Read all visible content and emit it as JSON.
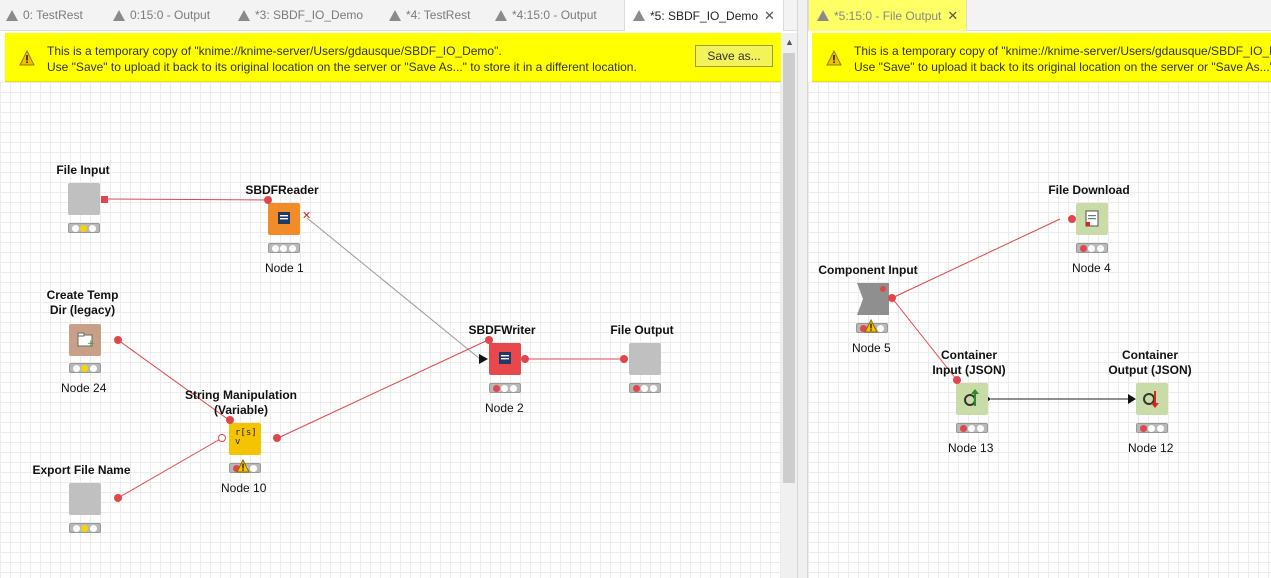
{
  "tabs": [
    {
      "label": "0: TestRest"
    },
    {
      "label": "0:15:0 - Output"
    },
    {
      "label": "*3: SBDF_IO_Demo"
    },
    {
      "label": "*4: TestRest"
    },
    {
      "label": "*4:15:0 - Output"
    },
    {
      "label": "*5: SBDF_IO_Demo"
    },
    {
      "label": "*5:15:0 - File Output"
    }
  ],
  "banner": {
    "line1": "This is a temporary copy of \"knime://knime-server/Users/gdausque/SBDF_IO_Demo\".",
    "line2": "Use \"Save\" to upload it back to its original location on the server or \"Save As...\" to store it in a different location.",
    "save_as": "Save as...",
    "line1_right": "This is a temporary copy of \"knime://knime-server/Users/gdausque/SBDF_IO_De",
    "line2_right": "Use \"Save\" to upload it back to its original location on the server or \"Save As...\" t"
  },
  "left_nodes": {
    "file_input": {
      "title": "File Input"
    },
    "sbdf_reader": {
      "title": "SBDFReader",
      "label": "Node 1"
    },
    "create_temp": {
      "title": "Create Temp\nDir (legacy)",
      "label": "Node 24"
    },
    "string_manip": {
      "title": "String Manipulation\n(Variable)",
      "label": "Node 10",
      "icon_text": "r[s]\nv"
    },
    "export_name": {
      "title": "Export File Name"
    },
    "sbdf_writer": {
      "title": "SBDFWriter",
      "label": "Node 2"
    },
    "file_output": {
      "title": "File Output"
    }
  },
  "right_nodes": {
    "file_download": {
      "title": "File Download",
      "label": "Node 4"
    },
    "component_input": {
      "title": "Component Input",
      "label": "Node 5"
    },
    "container_input": {
      "title": "Container\nInput (JSON)",
      "label": "Node 13"
    },
    "container_output": {
      "title": "Container\nOutput (JSON)",
      "label": "Node 12"
    }
  },
  "colors": {
    "banner": "#ffff00",
    "source_node": "#f28c28",
    "sink_node": "#e8474c",
    "manipulator_node": "#f5c400",
    "flow_node": "#c8a088",
    "component_node": "#c0c0c0",
    "json_node": "#c9dca8",
    "wire": "#e0474c"
  }
}
